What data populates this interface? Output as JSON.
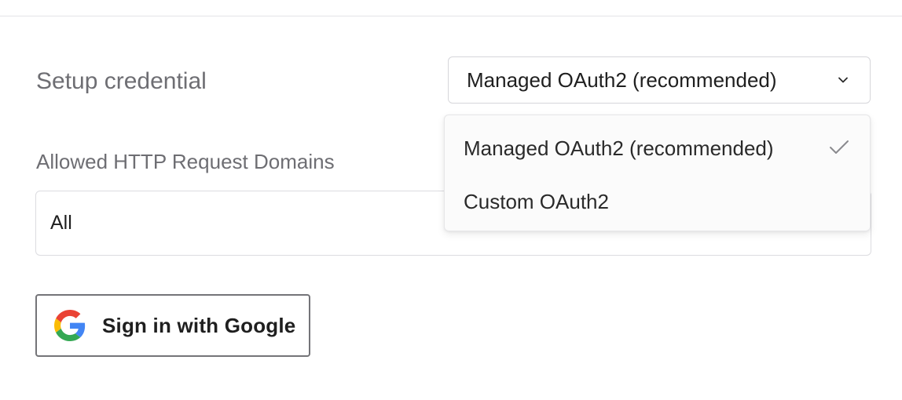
{
  "form": {
    "setup_label": "Setup credential",
    "setup_select": {
      "value": "Managed OAuth2 (recommended)",
      "options": [
        {
          "label": "Managed OAuth2 (recommended)",
          "selected": true
        },
        {
          "label": "Custom OAuth2",
          "selected": false
        }
      ]
    },
    "domains_label": "Allowed HTTP Request Domains",
    "domains_value": "All",
    "google_button_label": "Sign in with Google"
  },
  "icons": {
    "select_chevron": "chevron-down-icon",
    "selected_check": "check-icon",
    "google_logo": "google-g-logo"
  },
  "colors": {
    "label_text": "#6e6e73",
    "value_text": "#1f1f1f",
    "border": "#d6d6da",
    "button_border": "#747478",
    "dropdown_bg": "#fbfbfb",
    "check": "#8a8a8e"
  }
}
